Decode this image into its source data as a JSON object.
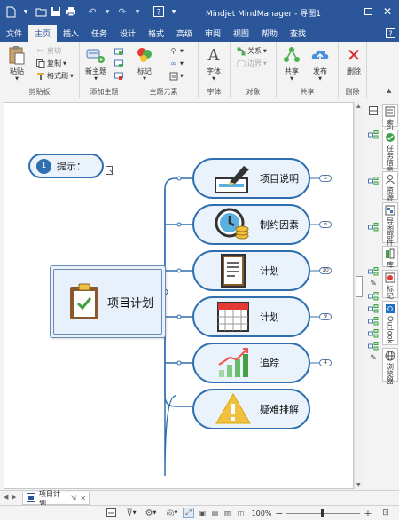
{
  "window": {
    "title": "Mindjet MindManager - 导图1"
  },
  "tabs": [
    "文件",
    "主页",
    "插入",
    "任务",
    "设计",
    "格式",
    "高级",
    "审阅",
    "视图",
    "帮助",
    "查找"
  ],
  "ribbon": {
    "clipboard": {
      "paste": "粘贴",
      "cut": "剪切",
      "copy": "复制",
      "format_painter": "格式刷",
      "label": "剪贴板"
    },
    "add_topic": {
      "new_topic": "新主题",
      "label": "添加主题"
    },
    "topic_elements": {
      "mark": "标记",
      "label": "主题元素"
    },
    "font": {
      "font": "字体",
      "label": "字体"
    },
    "object": {
      "relation": "关系",
      "boundary": "边界",
      "label": "对象"
    },
    "share": {
      "share": "共享",
      "publish": "发布",
      "label": "共享"
    },
    "delete": {
      "delete": "删除",
      "label": "删除"
    }
  },
  "right_panel": {
    "tabs": [
      "索引",
      "任务信息",
      "资源",
      "导图部件",
      "库",
      "标记",
      "Outlook",
      "浏览器"
    ]
  },
  "map": {
    "callout": {
      "number": "1",
      "text": "提示："
    },
    "central_topic": "项目计划",
    "topics": [
      {
        "text": "项目说明",
        "icon": "pen-signature-icon",
        "badge": "5"
      },
      {
        "text": "制约因素",
        "icon": "clock-coins-icon",
        "badge": "6"
      },
      {
        "text": "计划",
        "icon": "document-icon",
        "badge": "10"
      },
      {
        "text": "计划",
        "icon": "calendar-icon",
        "badge": "9"
      },
      {
        "text": "追踪",
        "icon": "bar-chart-icon",
        "badge": "4"
      },
      {
        "text": "疑难排解",
        "icon": "warning-icon",
        "badge": ""
      }
    ]
  },
  "doc_tab": {
    "label": "项目计划"
  },
  "status": {
    "zoom": "100%"
  },
  "colors": {
    "accent": "#2b579a",
    "topic_border": "#2f6fb0",
    "topic_fill": "#eaf2fb"
  }
}
